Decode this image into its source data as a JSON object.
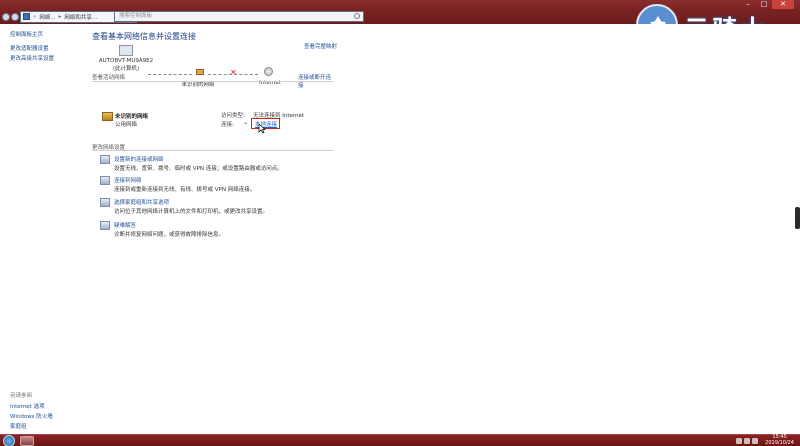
{
  "address": {
    "crumbs": [
      "网络...",
      "网络和共享..."
    ],
    "search_placeholder": "搜索控制面板"
  },
  "left_pane": {
    "links": [
      "控制面板主页",
      "更改适配器设置",
      "更改高级共享设置"
    ],
    "see_also_title": "另请参阅",
    "see_also": [
      "Internet 选项",
      "Windows 防火墙",
      "家庭组"
    ]
  },
  "main": {
    "title": "查看基本网络信息并设置连接",
    "full_map_link": "查看完整映射",
    "map": {
      "computer_name": "AUTOBVT-MU9A9E2",
      "computer_sub": "(此计算机)",
      "network_label": "未识别的网络",
      "internet_label": "Internet"
    },
    "active_section": {
      "heading": "查看活动网络",
      "connect_link": "连接或断开连接",
      "network_name": "未识别的网络",
      "network_type": "公用网络",
      "access_type_label": "访问类型:",
      "access_type_value": "无法连接到 Internet",
      "connections_label": "连接:",
      "connection_link": "本地连接"
    },
    "settings_section": {
      "heading": "更改网络设置",
      "tasks": [
        {
          "link": "设置新的连接或网络",
          "desc": "设置无线、宽带、拨号、临时或 VPN 连接；或设置路由器或访问点。"
        },
        {
          "link": "连接到网络",
          "desc": "连接到或重新连接到无线、有线、拨号或 VPN 网络连接。"
        },
        {
          "link": "选择家庭组和共享选项",
          "desc": "访问位于其他网络计算机上的文件和打印机，或更改共享设置。"
        },
        {
          "link": "疑难解答",
          "desc": "诊断并修复网络问题，或获得故障排除信息。"
        }
      ]
    }
  },
  "watermark": {
    "text": "云骑士"
  },
  "taskbar": {
    "time": "15:45",
    "date": "2019/10/24"
  },
  "colors": {
    "titlebar": "#7b2323",
    "link": "#1d4f91",
    "highlight_box": "#d42424"
  }
}
